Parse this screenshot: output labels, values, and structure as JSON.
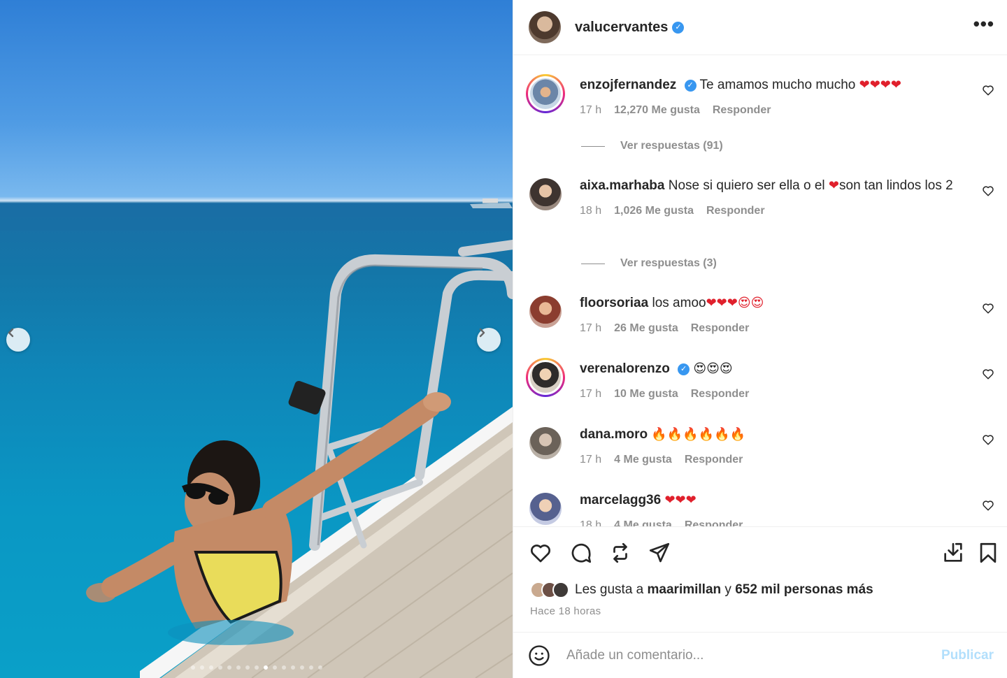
{
  "post": {
    "author": "valucervantes",
    "author_verified": true,
    "more_label": "•••"
  },
  "photo": {
    "image": "woman-in-sea-beside-boat-ladder",
    "carousel_dots": 15,
    "carousel_active_index": 8
  },
  "comments": [
    {
      "user": "enzojfernandez",
      "verified": true,
      "text": "Te amamos mucho mucho",
      "emoji": "❤❤❤❤",
      "time": "17 h",
      "likes": "12,270 Me gusta",
      "reply": "Responder",
      "view_replies": "Ver respuestas (91)",
      "ring": true
    },
    {
      "user": "aixa.marhaba",
      "verified": false,
      "text": "Nose si quiero ser ella o el",
      "emoji": "❤",
      "text2": "son tan lindos los 2",
      "time": "18 h",
      "likes": "1,026 Me gusta",
      "reply": "Responder",
      "view_replies": "Ver respuestas (3)",
      "ring": false
    },
    {
      "user": "floorsoriaa",
      "verified": false,
      "text": "los amoo",
      "emoji": "❤❤❤😍😍",
      "time": "17 h",
      "likes": "26 Me gusta",
      "reply": "Responder",
      "ring": false
    },
    {
      "user": "verenalorenzo",
      "verified": true,
      "text": "",
      "emoji": "😍😍😍",
      "time": "17 h",
      "likes": "10 Me gusta",
      "reply": "Responder",
      "ring": true
    },
    {
      "user": "dana.moro",
      "verified": false,
      "text": "",
      "emoji": "🔥🔥🔥🔥🔥🔥",
      "time": "17 h",
      "likes": "4 Me gusta",
      "reply": "Responder",
      "ring": false
    },
    {
      "user": "marcelagg36",
      "verified": false,
      "text": "",
      "emoji": "❤❤❤",
      "time": "18 h",
      "likes": "4 Me gusta",
      "reply": "Responder",
      "ring": false
    }
  ],
  "actions": {
    "icons": [
      "heart-icon",
      "comment-icon",
      "repost-icon",
      "share-icon",
      "download-icon",
      "bookmark-icon"
    ]
  },
  "likes": {
    "prefix": "Les gusta a",
    "user": "maarimillan",
    "connector": "y",
    "count": "652 mil personas más"
  },
  "timestamp": "Hace 18 horas",
  "composer": {
    "placeholder": "Añade un comentario...",
    "publish": "Publicar"
  },
  "colors": {
    "verified": "#3897f0",
    "publish_disabled": "#b2dffc",
    "secondary_text": "#8e8e8e"
  }
}
